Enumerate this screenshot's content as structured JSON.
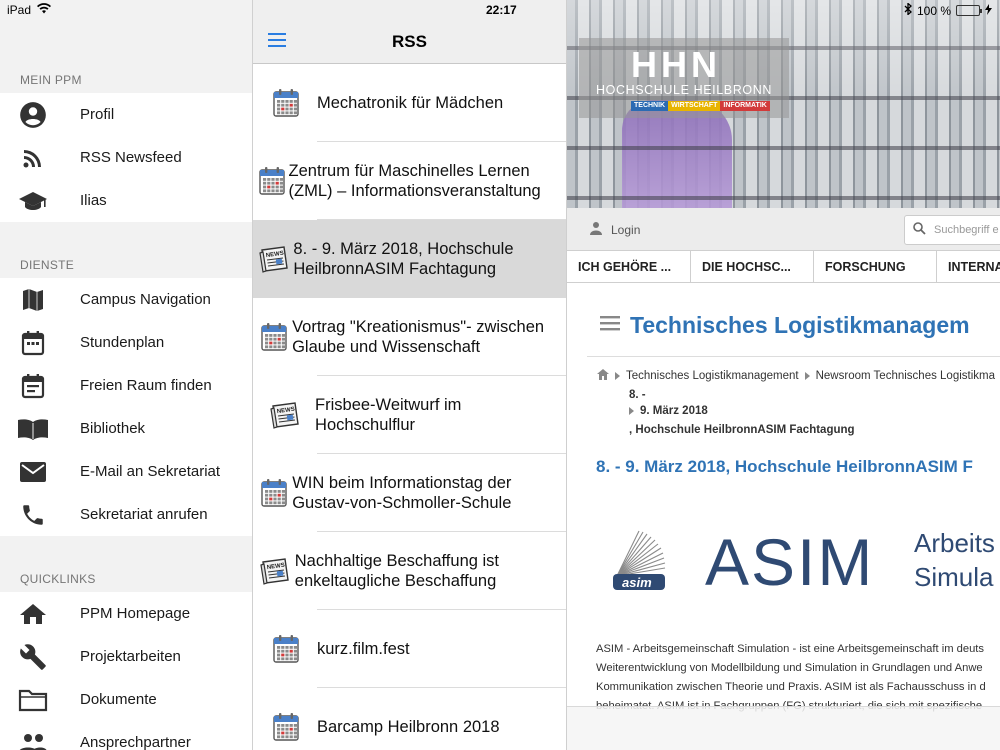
{
  "status": {
    "device": "iPad",
    "time": "22:17",
    "battery": "100 %"
  },
  "menu": {
    "sections": [
      {
        "title": "MEIN PPM",
        "items": [
          {
            "label": "Profil",
            "icon": "account-icon"
          },
          {
            "label": "RSS Newsfeed",
            "icon": "rss-icon"
          },
          {
            "label": "Ilias",
            "icon": "school-icon"
          }
        ]
      },
      {
        "title": "DIENSTE",
        "items": [
          {
            "label": "Campus Navigation",
            "icon": "map-icon"
          },
          {
            "label": "Stundenplan",
            "icon": "calendar-icon"
          },
          {
            "label": "Freien Raum finden",
            "icon": "event-note-icon"
          },
          {
            "label": "Bibliothek",
            "icon": "book-icon"
          },
          {
            "label": "E-Mail an Sekretariat",
            "icon": "mail-icon"
          },
          {
            "label": "Sekretariat anrufen",
            "icon": "phone-icon"
          }
        ]
      },
      {
        "title": "QUICKLINKS",
        "items": [
          {
            "label": "PPM Homepage",
            "icon": "home-icon"
          },
          {
            "label": "Projektarbeiten",
            "icon": "wrench-icon"
          },
          {
            "label": "Dokumente",
            "icon": "folder-icon"
          },
          {
            "label": "Ansprechpartner",
            "icon": "people-icon"
          }
        ]
      }
    ]
  },
  "rss": {
    "title": "RSS",
    "items": [
      {
        "title": "Mechatronik für Mädchen",
        "type": "calendar-icon",
        "selected": false
      },
      {
        "title": "Zentrum für Maschinelles Lernen (ZML) – Informationsveranstaltung",
        "type": "calendar-icon",
        "selected": false
      },
      {
        "title": "8. - 9. März 2018, Hochschule HeilbronnASIM Fachtagung",
        "type": "news-icon",
        "selected": true
      },
      {
        "title": "Vortrag \"Kreationismus\"- zwischen Glaube und Wissenschaft",
        "type": "calendar-icon",
        "selected": false
      },
      {
        "title": "Frisbee-Weitwurf im Hochschulflur",
        "type": "news-icon",
        "selected": false
      },
      {
        "title": "WIN beim Informationstag der Gustav-von-Schmoller-Schule",
        "type": "calendar-icon",
        "selected": false
      },
      {
        "title": "Nachhaltige Beschaffung ist enkeltaugliche Beschaffung",
        "type": "news-icon",
        "selected": false
      },
      {
        "title": "kurz.film.fest",
        "type": "calendar-icon",
        "selected": false
      },
      {
        "title": "Barcamp Heilbronn 2018",
        "type": "calendar-icon",
        "selected": false
      }
    ]
  },
  "web": {
    "logo": {
      "mark": "HHN",
      "name": "HOCHSCHULE HEILBRONN",
      "tags": [
        "TECHNIK",
        "WIRTSCHAFT",
        "INFORMATIK"
      ]
    },
    "login": "Login",
    "search_placeholder": "Suchbegriff e",
    "nav": [
      "ICH GEHÖRE ...",
      "DIE HOCHSC...",
      "FORSCHUNG",
      "INTERNA"
    ],
    "page_title": "Technisches Logistikmanagem",
    "breadcrumb": {
      "items": [
        "Technisches Logistikmanagement",
        "Newsroom Technisches Logistikma"
      ],
      "line2": "8. -",
      "line3": "9. März 2018",
      "line4": ", Hochschule HeilbronnASIM Fachtagung"
    },
    "article_title": "8. - 9. März 2018, Hochschule HeilbronnASIM F",
    "asim": {
      "logo_small": "asim",
      "big": "ASIM",
      "sub1": "Arbeits",
      "sub2": "Simula"
    },
    "paragraph": [
      "ASIM - Arbeitsgemeinschaft Simulation - ist eine Arbeitsgemeinschaft im deuts",
      "Weiterentwicklung von Modellbildung und Simulation in Grundlagen und Anwe",
      "Kommunikation zwischen Theorie und Praxis. ASIM ist als Fachausschuss in d",
      "beheimatet. ASIM ist in Fachgruppen (FG) strukturiert, die sich mit spezifische"
    ]
  },
  "colors": {
    "accent_blue": "#2f73b5",
    "ios_blue": "#2a7de1",
    "battery_green": "#4cd964",
    "logo_tag_blue": "#2b6bb3",
    "logo_tag_yellow": "#e8b400",
    "logo_tag_red": "#d23a3a"
  }
}
